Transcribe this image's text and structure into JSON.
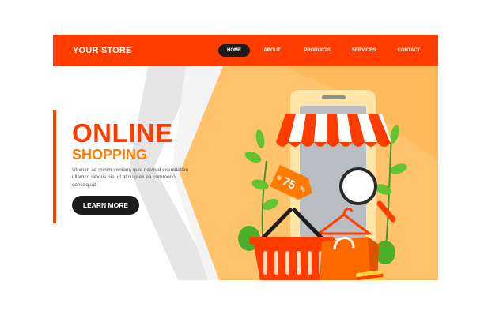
{
  "header": {
    "logo": "YOUR STORE",
    "nav": [
      {
        "label": "HOME",
        "active": true
      },
      {
        "label": "ABOUT",
        "active": false
      },
      {
        "label": "PRODUCTS",
        "active": false
      },
      {
        "label": "SERVICES",
        "active": false
      },
      {
        "label": "CONTACT",
        "active": false
      }
    ]
  },
  "hero": {
    "title_line1": "ONLINE",
    "title_line2": "SHOPPING",
    "body": "Ut enim ad minim veniam, quis nostrud exercitation ullamco laboris nisi ut aliquip ex ea commodo consequat.",
    "cta_label": "LEARN MORE"
  },
  "illustration": {
    "discount_tag": "75",
    "discount_symbol": "%",
    "icons": [
      "phone-icon",
      "awning-icon",
      "magnifier-icon",
      "shopping-basket-icon",
      "shopping-bag-icon",
      "credit-card-icon",
      "hanger-icon",
      "leaf-icon"
    ]
  },
  "colors": {
    "brand": "#ff3d00",
    "accent": "#ff7a00",
    "hero_background": "#ffc36b",
    "button": "#1c1c1c"
  }
}
